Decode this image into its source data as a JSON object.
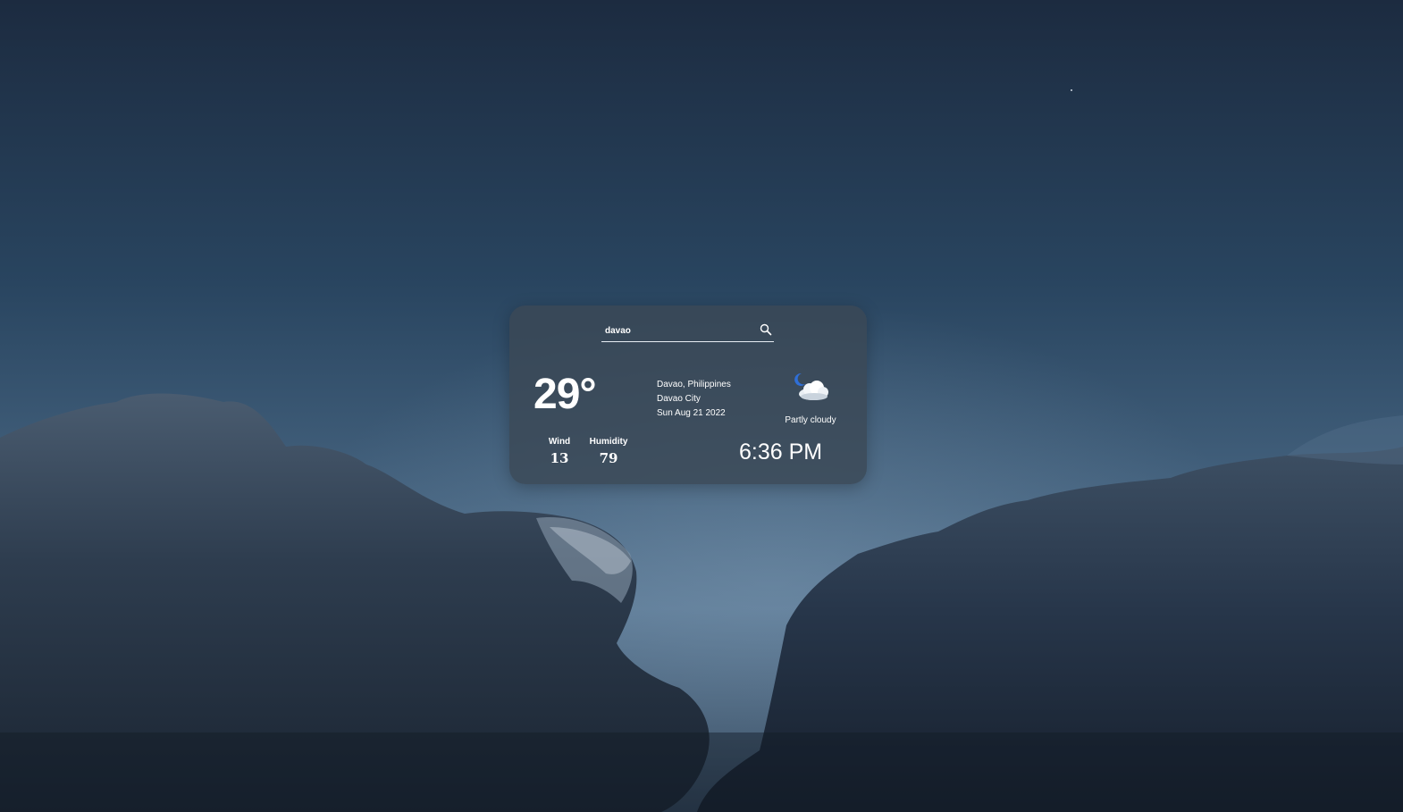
{
  "search": {
    "value": "davao",
    "placeholder": ""
  },
  "weather": {
    "temperature": "29°",
    "location_country": "Davao, Philippines",
    "city": "Davao City",
    "date": "Sun Aug 21 2022",
    "condition": "Partly cloudy",
    "condition_icon": "partly-cloudy-night-icon",
    "wind_label": "Wind",
    "wind_value": "13",
    "humidity_label": "Humidity",
    "humidity_value": "79",
    "time": "6:36 PM"
  },
  "colors": {
    "card_background": "#3a4856",
    "text": "#ffffff",
    "moon": "#2f6fd8"
  }
}
